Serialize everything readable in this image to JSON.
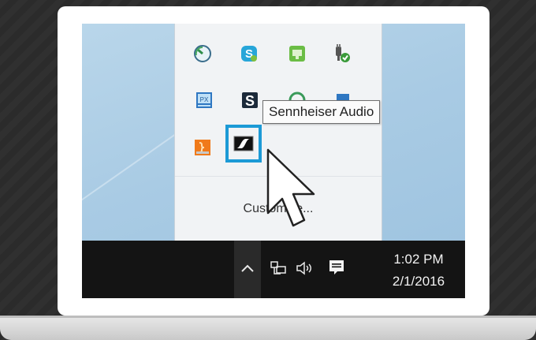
{
  "tray_popup": {
    "icons": [
      {
        "name": "gauge-app-icon"
      },
      {
        "name": "skype-icon"
      },
      {
        "name": "green-drive-icon"
      },
      {
        "name": "power-plug-check-icon"
      },
      {
        "name": "blue-display-icon"
      },
      {
        "name": "s-app-icon"
      },
      {
        "name": "green-circle-icon"
      },
      {
        "name": "blue-square-icon"
      },
      {
        "name": "orange-app-icon"
      },
      {
        "name": "sennheiser-audio-icon"
      }
    ],
    "customize_label": "Customize..."
  },
  "tooltip": {
    "text": "Sennheiser Audio"
  },
  "taskbar": {
    "icons": [
      "chevron-up-icon",
      "network-icon",
      "volume-icon",
      "action-center-icon"
    ],
    "time": "1:02 PM",
    "date": "2/1/2016"
  },
  "colors": {
    "highlight": "#1c9ad6",
    "taskbar": "#141414",
    "desktop": "#a9cbe4"
  }
}
